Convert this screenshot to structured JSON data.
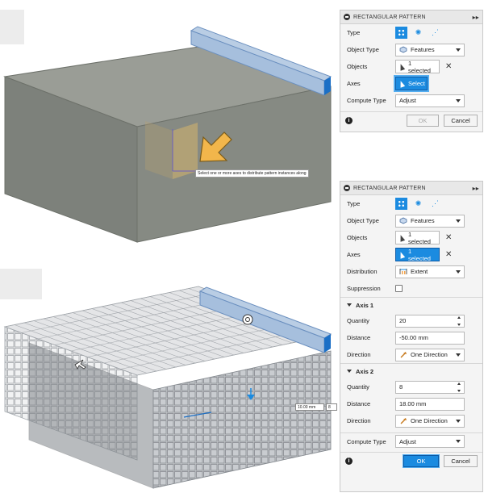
{
  "panel_top": {
    "title": "RECTANGULAR PATTERN",
    "type_label": "Type",
    "object_type_label": "Object Type",
    "object_type_value": "Features",
    "objects_label": "Objects",
    "objects_value": "1 selected",
    "axes_label": "Axes",
    "axes_value": "Select",
    "compute_type_label": "Compute Type",
    "compute_type_value": "Adjust",
    "ok_label": "OK",
    "cancel_label": "Cancel"
  },
  "panel_bottom": {
    "title": "RECTANGULAR PATTERN",
    "type_label": "Type",
    "object_type_label": "Object Type",
    "object_type_value": "Features",
    "objects_label": "Objects",
    "objects_value": "1 selected",
    "axes_label": "Axes",
    "axes_value": "1 selected",
    "distribution_label": "Distribution",
    "distribution_value": "Extent",
    "suppression_label": "Suppression",
    "axis1": {
      "title": "Axis 1",
      "quantity_label": "Quantity",
      "quantity_value": "20",
      "distance_label": "Distance",
      "distance_value": "-50.00 mm",
      "direction_label": "Direction",
      "direction_value": "One Direction"
    },
    "axis2": {
      "title": "Axis 2",
      "quantity_label": "Quantity",
      "quantity_value": "8",
      "distance_label": "Distance",
      "distance_value": "18.00 mm",
      "direction_label": "Direction",
      "direction_value": "One Direction"
    },
    "compute_type_label": "Compute Type",
    "compute_type_value": "Adjust",
    "ok_label": "OK",
    "cancel_label": "Cancel"
  },
  "viewport": {
    "tooltip": "Select one or more axes to distribute pattern instances along",
    "dim_value": "10.00 mm",
    "dim_value2": "8"
  },
  "colors": {
    "accent": "#1b8be0",
    "box_top": "#9a9d96",
    "box_front": "#7d817b",
    "box_side": "#8a8e87",
    "arrow": "#f2b64b"
  },
  "icons": [
    "info-icon",
    "select-arrow-icon",
    "close-icon",
    "features-icon",
    "extent-icon",
    "direction-icon",
    "rectangular-pattern-icon",
    "circular-pattern-icon",
    "path-pattern-icon",
    "expand-icon",
    "rotate-icon"
  ]
}
